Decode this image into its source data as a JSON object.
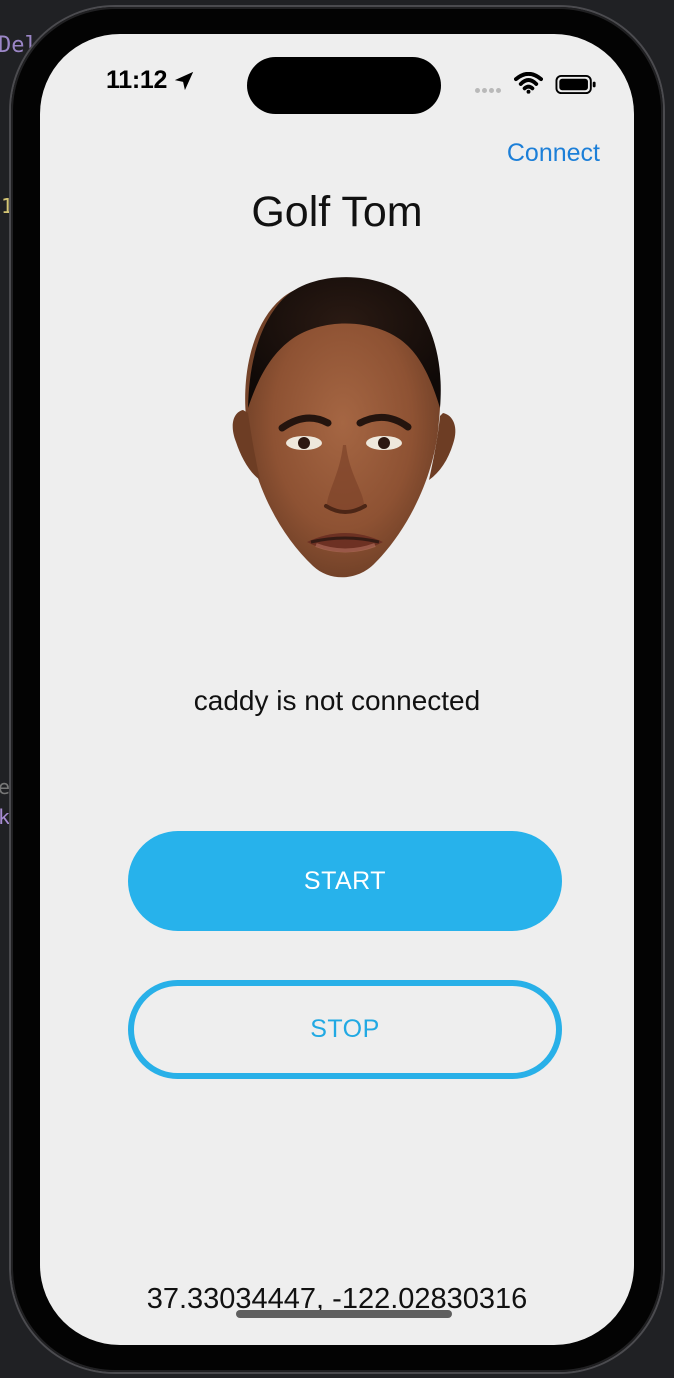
{
  "background_code": [
    "Dele",
    "1",
    "e",
    "k"
  ],
  "status_bar": {
    "time": "11:12",
    "location_icon": "location-arrow-icon",
    "signal_icon": "cellular-signal-icon",
    "wifi_icon": "wifi-icon",
    "battery_icon": "battery-icon"
  },
  "navigation": {
    "connect_label": "Connect"
  },
  "app": {
    "title": "Golf Tom",
    "portrait_icon": "golfer-face-image",
    "connection_status": "caddy is not connected",
    "coordinates": "37.33034447, -122.02830316"
  },
  "controls": {
    "start_label": "START",
    "stop_label": "STOP"
  },
  "colors": {
    "screen_background": "#eeeeee",
    "accent_blue": "#27b2eb",
    "connect_blue": "#1c7fd8",
    "text": "#111111"
  }
}
